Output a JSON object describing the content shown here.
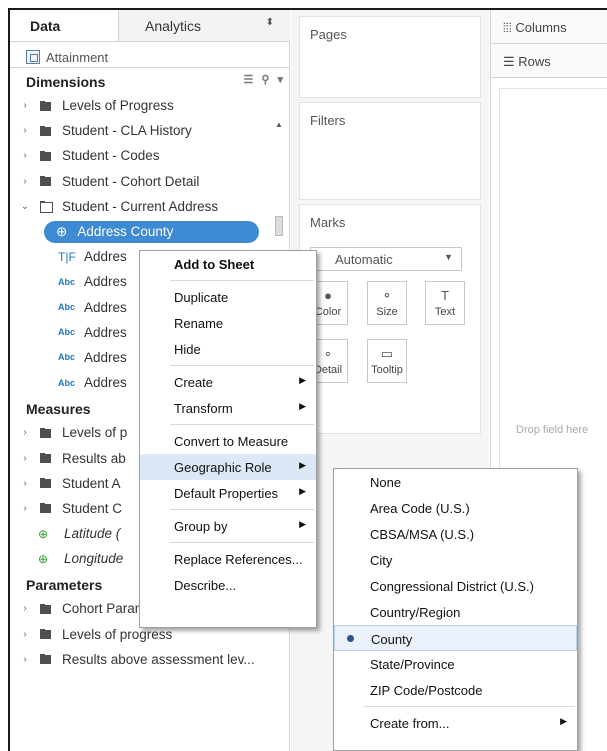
{
  "tabs": {
    "data": "Data",
    "analytics": "Analytics"
  },
  "datasource": {
    "name": "Attainment"
  },
  "dimensions": {
    "title": "Dimensions",
    "folders": [
      "Levels of Progress",
      "Student - CLA History",
      "Student - Codes",
      "Student - Cohort Detail",
      "Student - Current Address"
    ],
    "fields": [
      {
        "icon": "geo-icon",
        "type": "⊕",
        "label": "Address County"
      },
      {
        "icon": "text-type-icon",
        "type": "T|F",
        "label": "Addres"
      },
      {
        "icon": "abc-icon",
        "type": "Abc",
        "label": "Addres"
      },
      {
        "icon": "abc-icon",
        "type": "Abc",
        "label": "Addres"
      },
      {
        "icon": "abc-icon",
        "type": "Abc",
        "label": "Addres"
      },
      {
        "icon": "abc-icon",
        "type": "Abc",
        "label": "Addres"
      },
      {
        "icon": "abc-icon",
        "type": "Abc",
        "label": "Addres"
      }
    ]
  },
  "measures": {
    "title": "Measures",
    "folders": [
      "Levels of p",
      "Results ab",
      "Student A",
      "Student C"
    ],
    "fields": [
      "Latitude (",
      "Longitude"
    ]
  },
  "parameters": {
    "title": "Parameters",
    "folders": [
      "Cohort Parameters",
      "Levels of progress",
      "Results above assessment lev..."
    ]
  },
  "shelves": {
    "pages": "Pages",
    "filters": "Filters",
    "marks": "Marks",
    "columns": "Columns",
    "rows": "Rows"
  },
  "marks": {
    "type": "Automatic",
    "color": "Color",
    "size": "Size",
    "text": "Text",
    "detail": "Detail",
    "tooltip": "Tooltip"
  },
  "canvas": {
    "drop_hint": "Drop field here"
  },
  "context_menu": {
    "add_to_sheet": "Add to Sheet",
    "duplicate": "Duplicate",
    "rename": "Rename",
    "hide": "Hide",
    "create": "Create",
    "transform": "Transform",
    "convert": "Convert to Measure",
    "geographic_role": "Geographic Role",
    "default_properties": "Default Properties",
    "group_by": "Group by",
    "replace_references": "Replace References...",
    "describe": "Describe..."
  },
  "geo_submenu": {
    "items": [
      "None",
      "Area Code (U.S.)",
      "CBSA/MSA (U.S.)",
      "City",
      "Congressional District (U.S.)",
      "Country/Region",
      "County",
      "State/Province",
      "ZIP Code/Postcode"
    ],
    "selected": "County",
    "create_from": "Create from..."
  }
}
